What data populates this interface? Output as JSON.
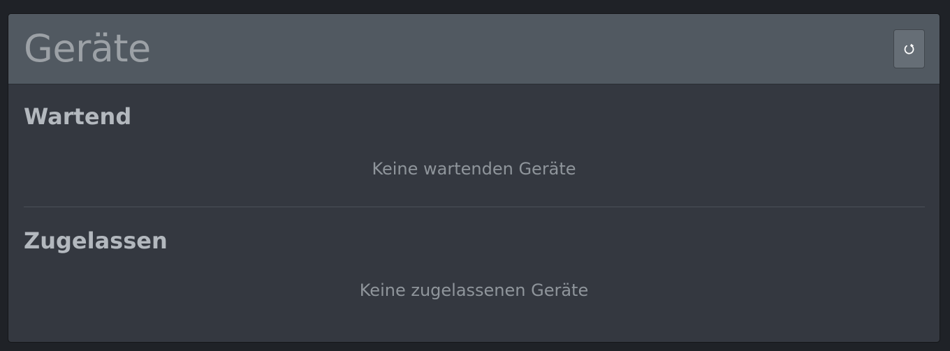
{
  "panel": {
    "title": "Geräte",
    "refresh_icon": "refresh-icon"
  },
  "sections": {
    "waiting": {
      "title": "Wartend",
      "empty_text": "Keine wartenden Geräte"
    },
    "approved": {
      "title": "Zugelassen",
      "empty_text": "Keine zugelassenen Geräte"
    }
  }
}
